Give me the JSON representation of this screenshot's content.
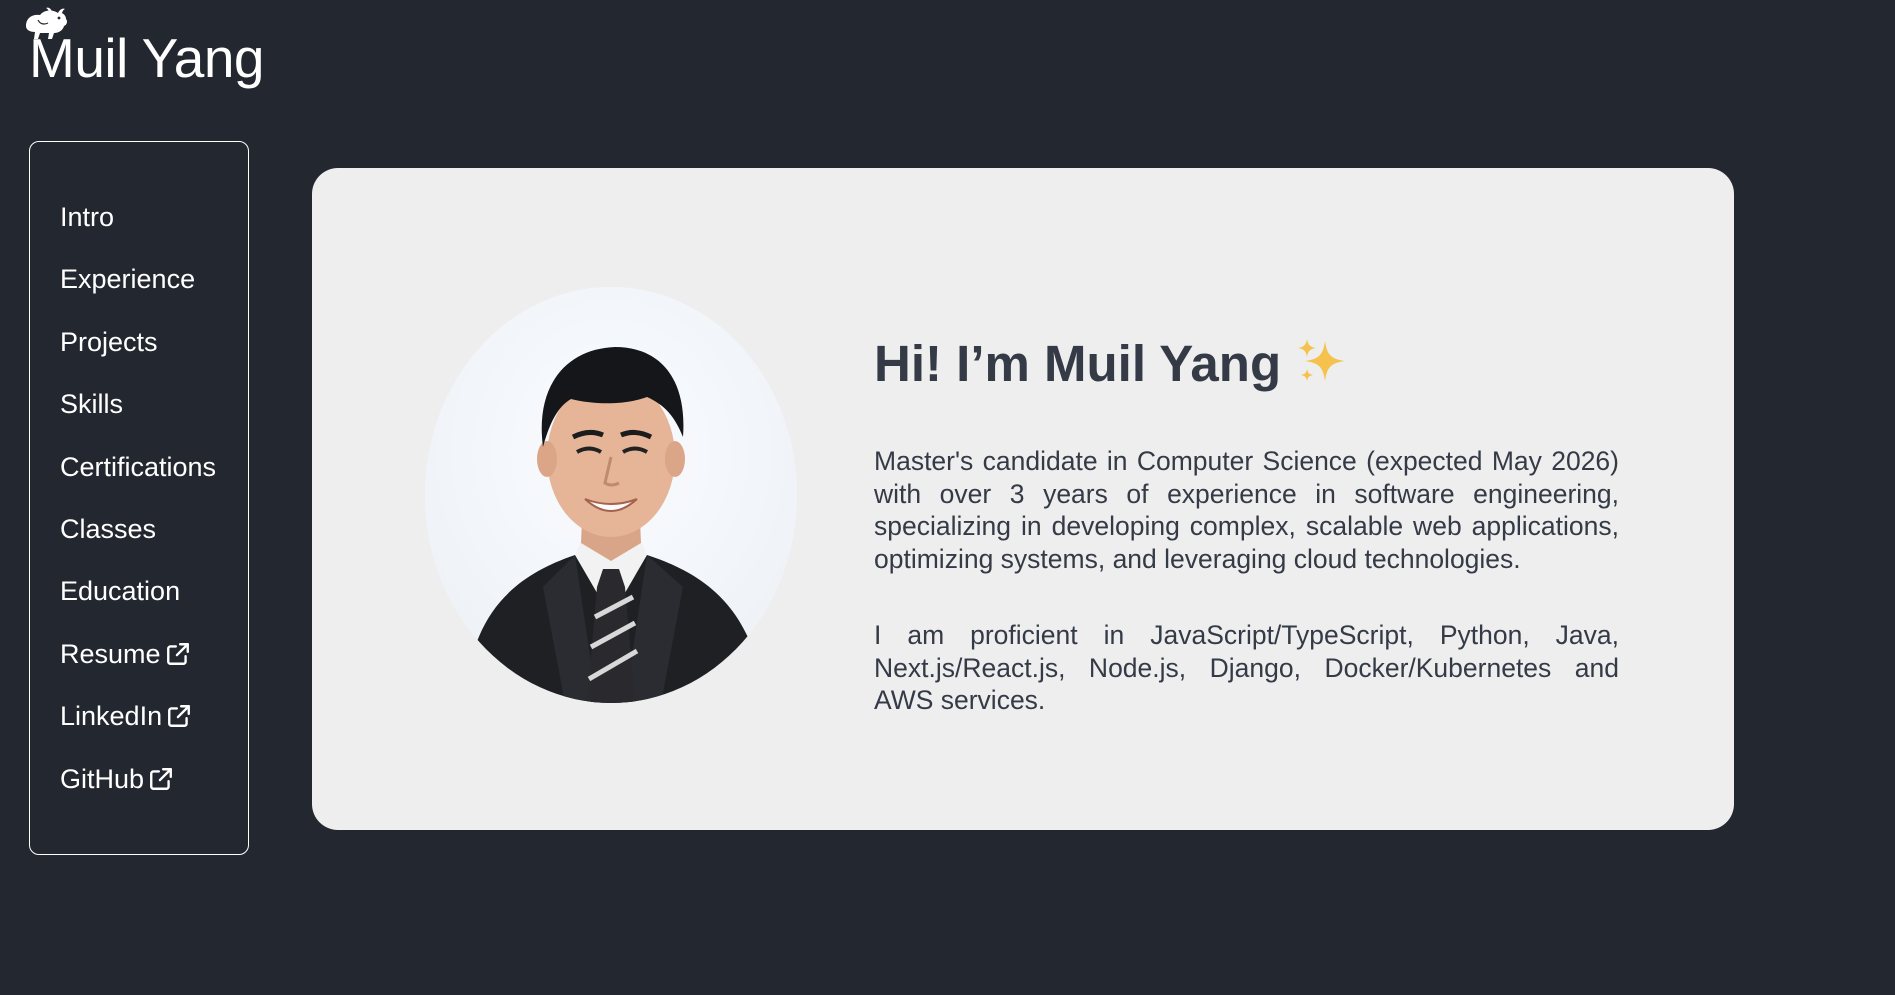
{
  "header": {
    "logo_icon": "bull-logo-icon",
    "title": "Muil Yang"
  },
  "sidebar": {
    "items": [
      {
        "label": "Intro",
        "external": false
      },
      {
        "label": "Experience",
        "external": false
      },
      {
        "label": "Projects",
        "external": false
      },
      {
        "label": "Skills",
        "external": false
      },
      {
        "label": "Certifications",
        "external": false
      },
      {
        "label": "Classes",
        "external": false
      },
      {
        "label": "Education",
        "external": false
      },
      {
        "label": "Resume",
        "external": true,
        "icon": "external-link-icon"
      },
      {
        "label": "LinkedIn",
        "external": true,
        "icon": "external-link-icon"
      },
      {
        "label": "GitHub",
        "external": true,
        "icon": "external-link-icon"
      }
    ]
  },
  "intro": {
    "greeting": "Hi! I’m Muil Yang",
    "greeting_icon": "sparkles-icon",
    "paragraphs": [
      "Master's candidate in Computer Science (expected May 2026) with over 3 years of experience in software engineering, specializing in developing complex, scalable web applications, optimizing systems, and leveraging cloud technologies.",
      "I am proficient in JavaScript/TypeScript, Python, Java, Next.js/React.js, Node.js, Django, Docker/Kubernetes and AWS services."
    ],
    "portrait": "profile-photo"
  },
  "colors": {
    "background": "#23272f",
    "card": "#eeeeee",
    "text_dark": "#343a46",
    "text_light": "#ffffff",
    "accent_sparkle": "#f4c24d"
  }
}
